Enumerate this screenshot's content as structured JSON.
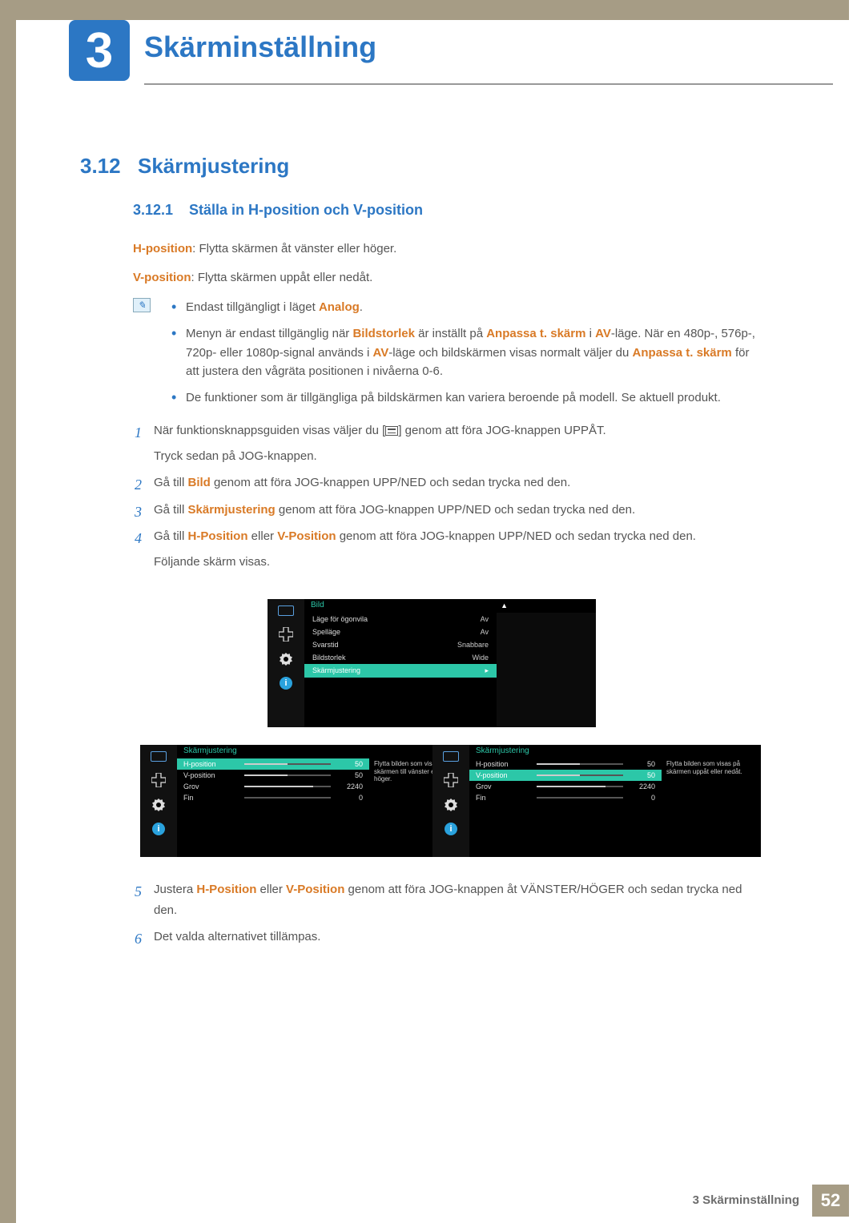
{
  "chapter": {
    "number": "3",
    "title": "Skärminställning"
  },
  "section": {
    "number": "3.12",
    "title": "Skärmjustering"
  },
  "subsection": {
    "number": "3.12.1",
    "title": "Ställa in H-position och V-position"
  },
  "definitions": {
    "h_label": "H-position",
    "h_text": ": Flytta skärmen åt vänster eller höger.",
    "v_label": "V-position",
    "v_text": ": Flytta skärmen uppåt eller nedåt."
  },
  "notes": {
    "analog_pre": "Endast tillgängligt i läget ",
    "analog_em": "Analog",
    "analog_post": ".",
    "l2_a": "Menyn är endast tillgänglig när ",
    "l2_b": "Bildstorlek",
    "l2_c": " är inställt på ",
    "l2_d": "Anpassa t. skärm",
    "l2_e": " i ",
    "l2_f": "AV",
    "l2_g": "-läge. När en 480p-, 576p-, 720p- eller 1080p-signal används i ",
    "l2_h": "AV",
    "l2_i": "-läge och bildskärmen visas normalt väljer du ",
    "l2_j": "Anpassa t. skärm",
    "l2_k": " för att justera den vågräta positionen i nivåerna 0-6.",
    "l3": "De funktioner som är tillgängliga på bildskärmen kan variera beroende på modell. Se aktuell produkt."
  },
  "steps": {
    "s1_num": "1",
    "s1a_pre": "När funktionsknappsguiden visas väljer du [",
    "s1a_post": "] genom att föra JOG-knappen UPPÅT.",
    "s1b": "Tryck sedan på JOG-knappen.",
    "s2_num": "2",
    "s2_pre": "Gå till ",
    "s2_em": "Bild",
    "s2_post": " genom att föra JOG-knappen UPP/NED och sedan trycka ned den.",
    "s3_num": "3",
    "s3_pre": "Gå till ",
    "s3_em": "Skärmjustering",
    "s3_post": " genom att föra JOG-knappen UPP/NED och sedan trycka ned den.",
    "s4_num": "4",
    "s4_pre": "Gå till ",
    "s4_em1": "H-Position",
    "s4_mid": " eller ",
    "s4_em2": "V-Position",
    "s4_post": " genom att föra JOG-knappen UPP/NED och sedan trycka ned den.",
    "s4b": "Följande skärm visas.",
    "s5_num": "5",
    "s5_pre": "Justera ",
    "s5_em1": "H-Position",
    "s5_mid": " eller ",
    "s5_em2": "V-Position",
    "s5_post": " genom att föra JOG-knappen åt VÄNSTER/HÖGER och sedan trycka ned den.",
    "s6_num": "6",
    "s6": "Det valda alternativet tillämpas."
  },
  "osd1": {
    "title": "Bild",
    "rows": [
      {
        "label": "Läge för ögonvila",
        "value": "Av"
      },
      {
        "label": "Spelläge",
        "value": "Av"
      },
      {
        "label": "Svarstid",
        "value": "Snabbare"
      },
      {
        "label": "Bildstorlek",
        "value": "Wide"
      }
    ],
    "selected": "Skärmjustering"
  },
  "osd_adjust": {
    "title": "Skärmjustering",
    "rows": [
      {
        "label": "H-position",
        "value": "50",
        "fill": 50
      },
      {
        "label": "V-position",
        "value": "50",
        "fill": 50
      },
      {
        "label": "Grov",
        "value": "2240",
        "fill": 80
      },
      {
        "label": "Fin",
        "value": "0",
        "fill": 0
      }
    ],
    "tip_h": "Flytta bilden som visas på skärmen till vänster eller höger.",
    "tip_v": "Flytta bilden som visas på skärmen uppåt eller nedåt."
  },
  "footer": {
    "label": "3 Skärminställning",
    "page": "52"
  },
  "icons": {
    "info": "i"
  }
}
